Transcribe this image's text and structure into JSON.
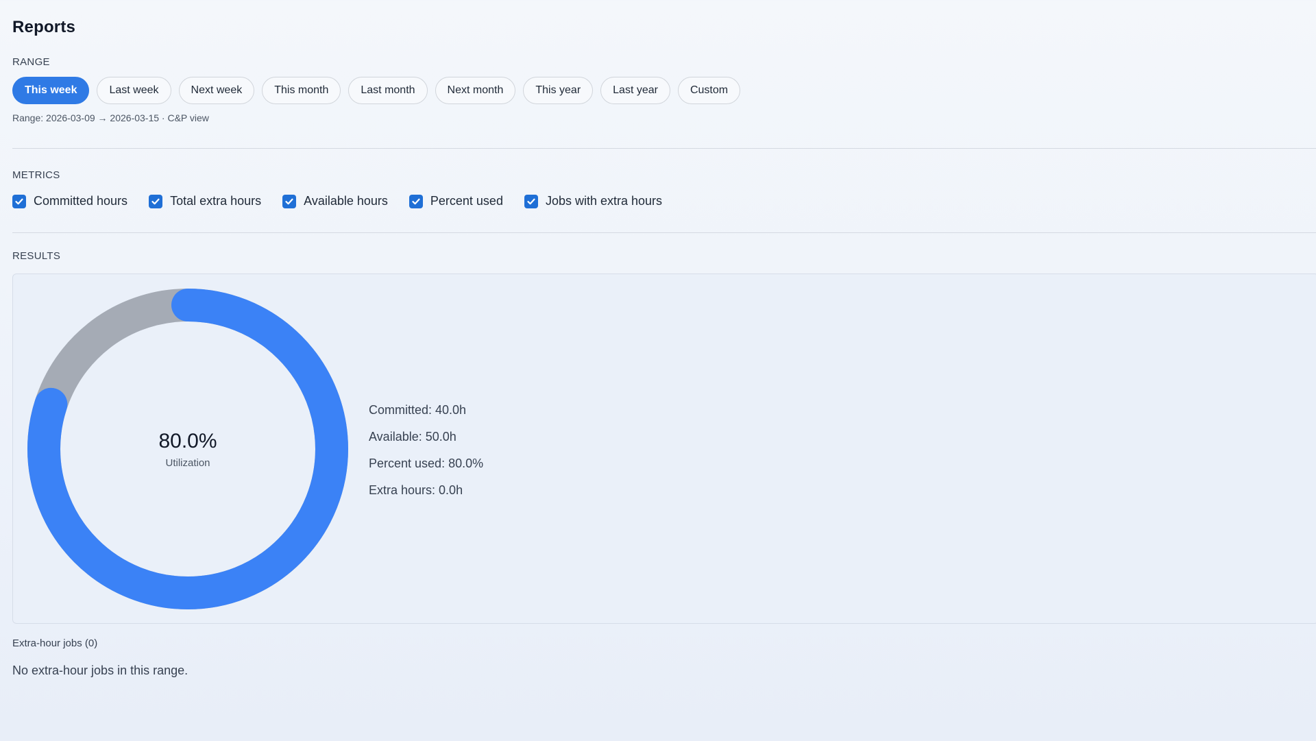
{
  "page": {
    "title": "Reports"
  },
  "range": {
    "label": "RANGE",
    "chips": [
      {
        "label": "This week",
        "active": true
      },
      {
        "label": "Last week",
        "active": false
      },
      {
        "label": "Next week",
        "active": false
      },
      {
        "label": "This month",
        "active": false
      },
      {
        "label": "Last month",
        "active": false
      },
      {
        "label": "Next month",
        "active": false
      },
      {
        "label": "This year",
        "active": false
      },
      {
        "label": "Last year",
        "active": false
      },
      {
        "label": "Custom",
        "active": false
      }
    ],
    "info": "Range: 2026-03-09 → 2026-03-15 · C&P view"
  },
  "metrics": {
    "label": "METRICS",
    "items": [
      {
        "label": "Committed hours",
        "checked": true
      },
      {
        "label": "Total extra hours",
        "checked": true
      },
      {
        "label": "Available hours",
        "checked": true
      },
      {
        "label": "Percent used",
        "checked": true
      },
      {
        "label": "Jobs with extra hours",
        "checked": true
      }
    ]
  },
  "results": {
    "label": "RESULTS",
    "donut": {
      "value_text": "80.0%",
      "caption": "Utilization",
      "percent_used": 80.0,
      "used_color": "#3b82f6",
      "remaining_color": "#a5abb5"
    },
    "stats": {
      "committed": "Committed: 40.0h",
      "available": "Available: 50.0h",
      "percent_used": "Percent used: 80.0%",
      "extra_hours": "Extra hours: 0.0h"
    }
  },
  "jobs": {
    "label": "Extra-hour jobs (0)",
    "empty_message": "No extra-hour jobs in this range."
  },
  "icons": {
    "checkbox": "check-icon"
  }
}
